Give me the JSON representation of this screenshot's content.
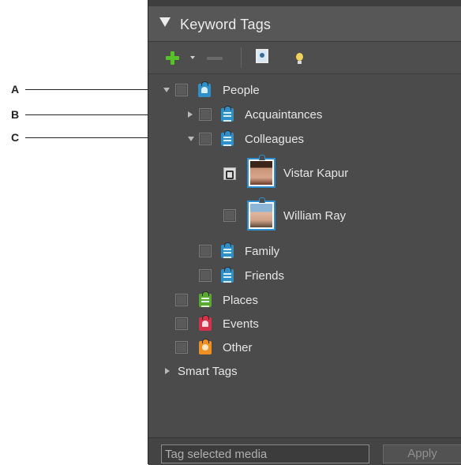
{
  "panel": {
    "title": "Keyword Tags"
  },
  "toolbar": {
    "new_tag": "plus-icon",
    "dropdown": "caret-down-icon",
    "delete_tag": "minus-icon",
    "edit_icon": "photo-icon",
    "hint": "lightbulb-icon"
  },
  "tree": {
    "people": "People",
    "acquaintances": "Acquaintances",
    "colleagues": "Colleagues",
    "vistar": "Vistar Kapur",
    "william": "William Ray",
    "family": "Family",
    "friends": "Friends",
    "places": "Places",
    "events": "Events",
    "other": "Other",
    "smart_tags": "Smart Tags"
  },
  "bottom": {
    "placeholder": "Tag selected media",
    "apply": "Apply"
  },
  "callouts": {
    "a": "A",
    "b": "B",
    "c": "C"
  },
  "colors": {
    "people_tag": "#2f8fc9",
    "places_tag": "#5aaa32",
    "events_tag": "#d2334b",
    "other_tag": "#ee8f1f",
    "plus": "#58c12a"
  }
}
